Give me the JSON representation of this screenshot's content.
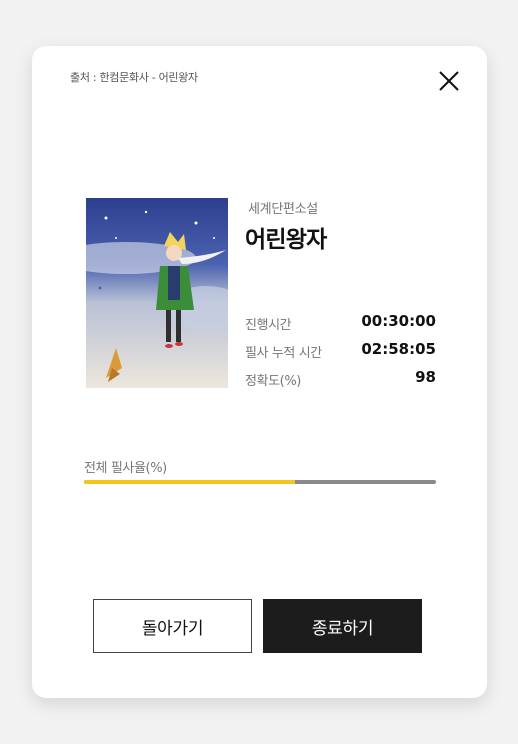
{
  "modal": {
    "source_text": "출처 : 한컴문화사 - 어린왕자",
    "close_icon": "close-icon"
  },
  "book": {
    "category": "세계단편소설",
    "title": "어린왕자",
    "cover_image": "little-prince-cover"
  },
  "stats": [
    {
      "label": "진행시간",
      "value": "00:30:00"
    },
    {
      "label": "필사 누적 시간",
      "value": "02:58:05"
    },
    {
      "label": "정확도(%)",
      "value": "98"
    }
  ],
  "progress": {
    "label": "전체 필사율(%)",
    "fraction": 0.6,
    "fill_color": "#f5c51b",
    "track_color": "#8a8a8a"
  },
  "buttons": {
    "back_label": "돌아가기",
    "end_label": "종료하기"
  }
}
